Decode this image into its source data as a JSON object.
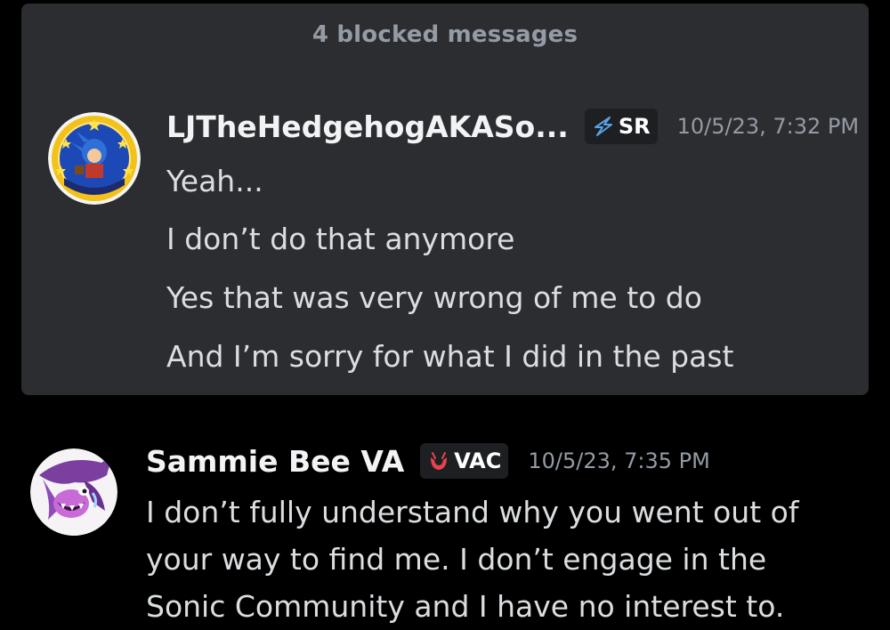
{
  "blocked": {
    "header": "4 blocked messages",
    "message": {
      "username": "LJTheHedgehogAKASo...",
      "tag": "SR",
      "timestamp": "10/5/23, 7:32 PM",
      "lines": [
        "Yeah...",
        "I don’t do that anymore",
        "Yes that was very wrong of me to do",
        "And I’m sorry for what I did in the past"
      ]
    }
  },
  "message2": {
    "username": "Sammie Bee VA",
    "tag": "VAC",
    "timestamp": "10/5/23, 7:35 PM",
    "lines": [
      "I don’t fully understand why you went out of",
      "your way to find me. I don’t engage in the",
      "Sonic Community and I have no interest to."
    ]
  },
  "colors": {
    "background": "#000000",
    "panel": "#2b2d31",
    "username": "#f2f3f5",
    "text": "#dbdee1",
    "muted": "#949ba4",
    "tag_bg": "#1e1f22",
    "sr_icon": "#5aa2e6",
    "vac_icon": "#e8434b"
  },
  "icons": {
    "sr_tag_icon": "lightning-bolt-icon",
    "vac_tag_icon": "shield-crescent-icon"
  }
}
